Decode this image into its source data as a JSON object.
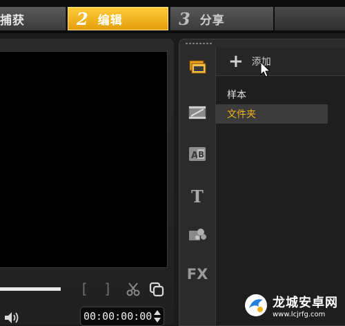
{
  "steps": {
    "capture": {
      "label": "捕获"
    },
    "edit": {
      "number": "2",
      "label": "编辑"
    },
    "share": {
      "number": "3",
      "label": "分享"
    }
  },
  "preview": {
    "mark_in": "[",
    "mark_out": "]",
    "timecode": "00:00:00:00"
  },
  "library": {
    "add_label": "添加",
    "folders": [
      {
        "label": "样本",
        "selected": false
      },
      {
        "label": "文件夹",
        "selected": true
      }
    ],
    "tabs": [
      "media-icon",
      "transition-icon",
      "title-ab-icon",
      "text-t-icon",
      "graphics-icon",
      "fx-filter-icon"
    ],
    "fx_label": "FX"
  },
  "watermark": {
    "title": "龙城安卓网",
    "url": "www.lcjrfg.com"
  },
  "colors": {
    "accent": "#f2b21b",
    "active_step": "#f5b21e",
    "background": "#1b1b1b"
  }
}
